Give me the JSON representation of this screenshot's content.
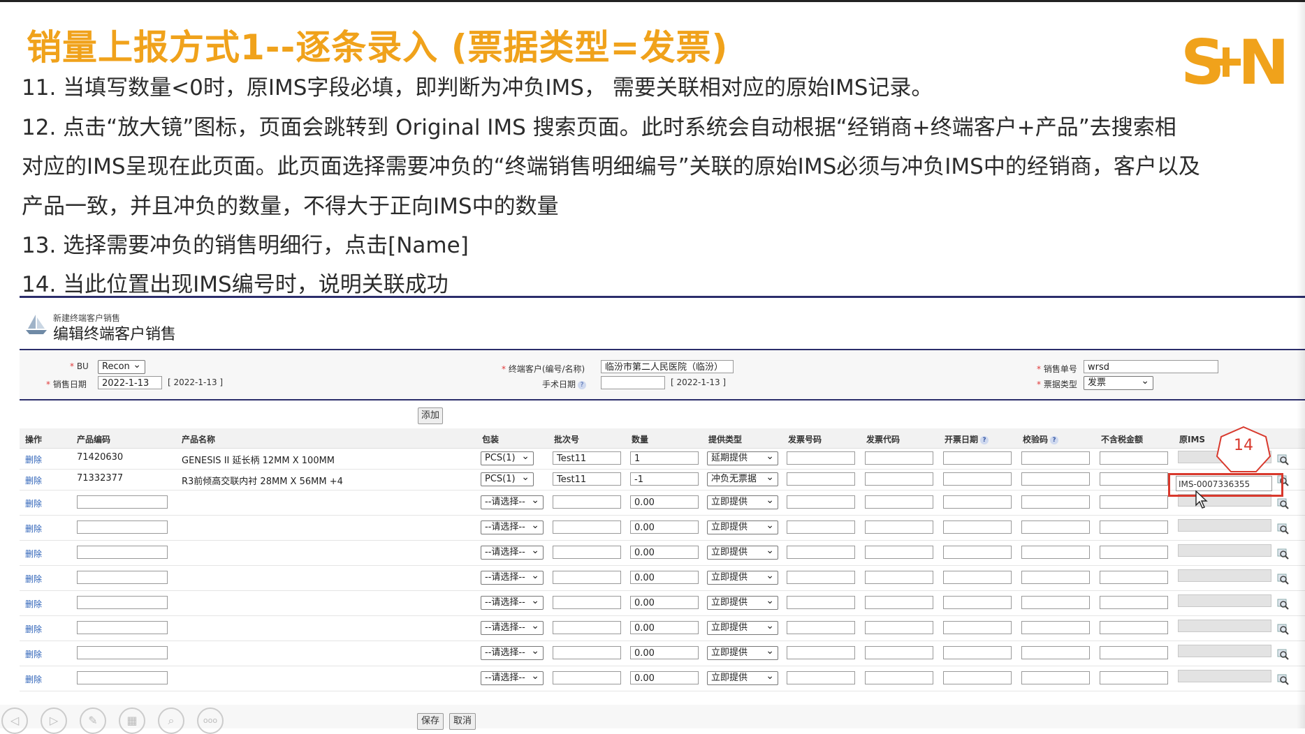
{
  "slide": {
    "title": "销量上报方式1--逐条录入 (票据类型=发票)",
    "logo_text": "S+N",
    "instructions": [
      "11. 当填写数量<0时，原IMS字段必填，即判断为冲负IMS， 需要关联相对应的原始IMS记录。",
      "12. 点击“放大镜”图标，页面会跳转到 Original IMS 搜索页面。此时系统会自动根据“经销商+终端客户+产品”去搜索相",
      "对应的IMS呈现在此页面。此页面选择需要冲负的“终端销售明细编号”关联的原始IMS必须与冲负IMS中的经销商，客户以及",
      "产品一致，并且冲负的数量，不得大于正向IMS中的数量",
      "13. 选择需要冲负的销售明细行，点击[Name]",
      "14. 当此位置出现IMS编号时，说明关联成功"
    ],
    "badge": "14",
    "colors": {
      "title": "#f0a21b",
      "accent": "#2b2d6b",
      "highlight": "#d8392d"
    }
  },
  "page": {
    "subtitle": "新建终端客户销售",
    "heading": "编辑终端客户销售"
  },
  "form": {
    "bu_label": "BU",
    "bu_value": "Recon",
    "sale_date_label": "销售日期",
    "sale_date_value": "2022-1-13",
    "sale_date_display": "[ 2022-1-13 ]",
    "customer_label": "终端客户(编号/名称)",
    "customer_value": "临汾市第二人民医院（临汾）",
    "surgery_date_label": "手术日期",
    "surgery_date_value": "",
    "surgery_date_display": "[ 2022-1-13 ]",
    "sale_no_label": "销售单号",
    "sale_no_value": "wrsd",
    "bill_type_label": "票据类型",
    "bill_type_value": "发票"
  },
  "add_button": "添加",
  "table": {
    "headers": [
      "操作",
      "产品编码",
      "产品名称",
      "包装",
      "批次号",
      "数量",
      "提供类型",
      "发票号码",
      "发票代码",
      "开票日期",
      "校验码",
      "不含税金额",
      "原IMS"
    ],
    "rows": [
      {
        "action": "删除",
        "code": "71420630",
        "name": "GENESIS II 延长柄 12MM X 100MM",
        "pack": "PCS(1)",
        "batch": "Test11",
        "qty": "1",
        "supply": "延期提供",
        "ims": ""
      },
      {
        "action": "删除",
        "code": "71332377",
        "name": "R3前倾高交联内衬 28MM X 56MM +4",
        "pack": "PCS(1)",
        "batch": "Test11",
        "qty": "-1",
        "supply": "冲负无票据",
        "ims": "IMS-0007336355"
      },
      {
        "action": "删除",
        "code": "",
        "name": "",
        "pack": "--请选择--",
        "batch": "",
        "qty": "0.00",
        "supply": "立即提供",
        "ims": ""
      },
      {
        "action": "删除",
        "code": "",
        "name": "",
        "pack": "--请选择--",
        "batch": "",
        "qty": "0.00",
        "supply": "立即提供",
        "ims": ""
      },
      {
        "action": "删除",
        "code": "",
        "name": "",
        "pack": "--请选择--",
        "batch": "",
        "qty": "0.00",
        "supply": "立即提供",
        "ims": ""
      },
      {
        "action": "删除",
        "code": "",
        "name": "",
        "pack": "--请选择--",
        "batch": "",
        "qty": "0.00",
        "supply": "立即提供",
        "ims": ""
      },
      {
        "action": "删除",
        "code": "",
        "name": "",
        "pack": "--请选择--",
        "batch": "",
        "qty": "0.00",
        "supply": "立即提供",
        "ims": ""
      },
      {
        "action": "删除",
        "code": "",
        "name": "",
        "pack": "--请选择--",
        "batch": "",
        "qty": "0.00",
        "supply": "立即提供",
        "ims": ""
      },
      {
        "action": "删除",
        "code": "",
        "name": "",
        "pack": "--请选择--",
        "batch": "",
        "qty": "0.00",
        "supply": "立即提供",
        "ims": ""
      },
      {
        "action": "删除",
        "code": "",
        "name": "",
        "pack": "--请选择--",
        "batch": "",
        "qty": "0.00",
        "supply": "立即提供",
        "ims": ""
      }
    ]
  },
  "footer": {
    "save_label": "保存",
    "cancel_label": "取消",
    "presenter_controls": [
      "prev-icon",
      "play-icon",
      "pen-icon",
      "grid-icon",
      "zoom-icon",
      "more-icon"
    ],
    "more_label": "ooo"
  }
}
